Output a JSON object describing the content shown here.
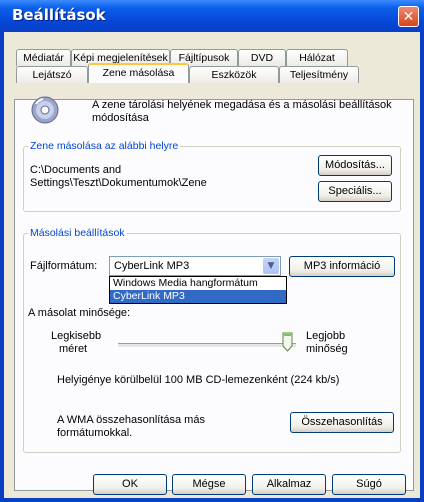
{
  "window": {
    "title": "Beállítások",
    "close_glyph": "✕"
  },
  "tabs_back": [
    "Médiatár",
    "Képi megjelenítések",
    "Fájltípusok",
    "DVD",
    "Hálózat"
  ],
  "tabs_front": [
    "Lejátszó",
    "Zene másolása",
    "Eszközök",
    "Teljesítmény"
  ],
  "active_tab": "Zene másolása",
  "intro_text": [
    "A zene tárolási helyének megadása és a másolási beállítások",
    "módosítása"
  ],
  "location_group": {
    "title": "Zene másolása az alábbi helyre",
    "path_lines": [
      "C:\\Documents and",
      "Settings\\Teszt\\Dokumentumok\\Zene"
    ],
    "change_button": "Módosítás...",
    "advanced_button": "Speciális..."
  },
  "copy_settings": {
    "title": "Másolási beállítások",
    "format_label": "Fájlformátum:",
    "format_value": "CyberLink MP3",
    "format_options": [
      "Windows Media hangformátum",
      "CyberLink MP3"
    ],
    "format_selected_option": "CyberLink MP3",
    "mp3_info_button": "MP3 információ",
    "quality_label": "A másolat minősége:",
    "smallest_label": [
      "Legkisebb",
      "méret"
    ],
    "best_label": [
      "Legjobb",
      "minőség"
    ],
    "quality_level": 0.93,
    "disk_usage": "Helyigénye körülbelül 100 MB CD-lemezenként (224 kb/s)",
    "compare_text": [
      "A WMA összehasonlítása más",
      "formátumokkal."
    ],
    "compare_button": "Összehasonlítás"
  },
  "footer": {
    "ok": "OK",
    "cancel": "Mégse",
    "apply": "Alkalmaz",
    "help": "Súgó"
  },
  "colors": {
    "title_bar": "#0a3fc4",
    "group_title": "#0046d5",
    "selection": "#316ac5",
    "active_tab_accent": "#ffc83c"
  },
  "icons": {
    "close": "close-icon",
    "disc": "cd-disc-icon",
    "dropdown": "chevron-down-icon",
    "slider_thumb": "slider-thumb-icon"
  }
}
